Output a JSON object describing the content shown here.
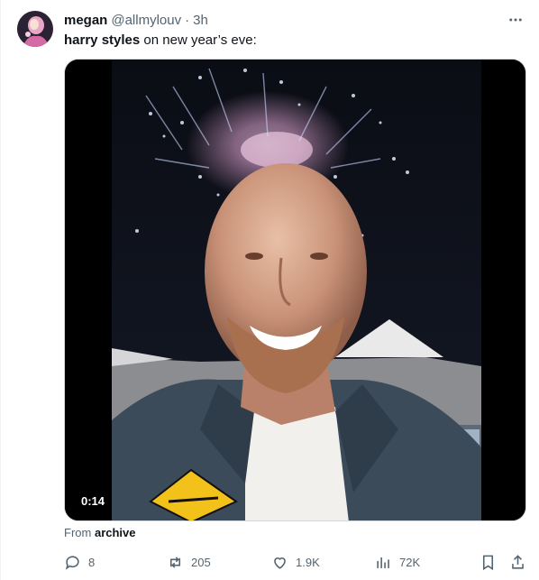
{
  "tweet": {
    "author_name": "megan",
    "handle": "@allmylouv",
    "separator": "·",
    "time": "3h",
    "text_bold": "harry styles",
    "text_rest": " on new year’s eve:",
    "video_duration": "0:14",
    "source_prefix": "From",
    "source_name": "archive"
  },
  "actions": {
    "replies": "8",
    "reposts": "205",
    "likes": "1.9K",
    "views": "72K"
  },
  "icons": [
    "more-icon",
    "reply-icon",
    "repost-icon",
    "like-icon",
    "views-icon",
    "bookmark-icon",
    "share-icon"
  ]
}
